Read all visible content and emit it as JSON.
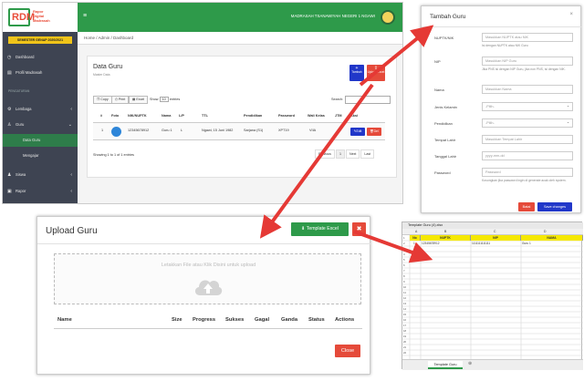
{
  "app": {
    "logo_letters": "RDM",
    "logo_text": [
      "Rapor",
      "Digital",
      "Madrasah"
    ],
    "semester": "SEMESTER GENAP 2020/2021",
    "school_name": "MADRASAH TSANAWIYAH NEGERI 1 NGAWI",
    "menu_icon": "hamburger-icon",
    "breadcrumb": "Home  /  Admin  /  Dashboard",
    "sidebar": {
      "items": [
        {
          "label": "Dashboard",
          "icon": "dashboard-icon"
        },
        {
          "label": "Profil Madrasah",
          "icon": "document-icon"
        }
      ],
      "section_header": "PENGATURAN",
      "items2": [
        {
          "label": "Lembaga",
          "icon": "gear-icon"
        },
        {
          "label": "Guru",
          "icon": "user-icon"
        },
        {
          "label": "Data Guru",
          "icon": ""
        },
        {
          "label": "Mengajar",
          "icon": ""
        },
        {
          "label": "Siswa",
          "icon": "group-icon"
        },
        {
          "label": "Rapor",
          "icon": "report-icon"
        }
      ]
    },
    "panel": {
      "title": "Data Guru",
      "subtitle": "Master Data",
      "tambah_label": "Tambah",
      "upload_label": "Upload Excel",
      "toolbar": {
        "copy": "Copy",
        "print": "Print",
        "excel": "Excel",
        "show": "Show",
        "show_value": "10",
        "entries": "entries",
        "search": "Search:"
      },
      "table": {
        "headers": [
          "#",
          "Foto",
          "NIK/NUPTK",
          "Nama",
          "L/P",
          "TTL",
          "Pendidikan",
          "Password",
          "Wali Kelas",
          "JTM",
          "Aksi"
        ],
        "rows": [
          {
            "no": "1",
            "nik": "12345678912",
            "nama": "Guru 1",
            "lp": "L",
            "ttl": "Ngawi, 15 Juni 1982",
            "pendidikan": "Sarjana (S1)",
            "password": "XPT19",
            "wali": "VIIA",
            "jtm": "0",
            "edit": "Edit",
            "del": "Del"
          }
        ]
      },
      "footer": "Showing 1 to 1 of 1 entries",
      "pager": {
        "prev": "Previous",
        "page": "1",
        "next": "Next",
        "last": "Last"
      }
    }
  },
  "tambah_modal": {
    "title": "Tambah Guru",
    "close": "×",
    "fields": [
      {
        "label": "NUPTK/NIK",
        "placeholder": "Masukkan NUPTK atau NIK",
        "help": "Isi dengan NUPTK atau NIK Guru"
      },
      {
        "label": "NIP",
        "placeholder": "Masukkan NIP Guru",
        "help": "Jika PNS isi dengan NIP Guru, jika non PNS, isi dengan NIK."
      },
      {
        "label": "Nama",
        "placeholder": "Masukkan Nama",
        "help": ""
      },
      {
        "label": "Jenis Kelamin",
        "placeholder": "-Pilih-",
        "help": ""
      },
      {
        "label": "Pendidikan",
        "placeholder": "-Pilih-",
        "help": ""
      },
      {
        "label": "Tempat Lahir",
        "placeholder": "Masukkan Tempat Lahir",
        "help": ""
      },
      {
        "label": "Tanggal Lahir",
        "placeholder": "yyyy-mm-dd",
        "help": ""
      },
      {
        "label": "Password",
        "placeholder": "Password",
        "help": "Kosongkan jika password ingin di generate acak oleh system."
      }
    ],
    "batal": "Batal",
    "save": "Save changes"
  },
  "upload_modal": {
    "title": "Upload Guru",
    "template_btn": "Template Excel",
    "close_x": "✖",
    "dropzone_text": "Letakkan File atau Klik Disini untuk upload",
    "headers": [
      "Name",
      "Size",
      "Progress",
      "Sukses",
      "Gagal",
      "Ganda",
      "Status",
      "Actions"
    ],
    "close_btn": "Close"
  },
  "excel": {
    "title": "Template Guru (4).xlsx",
    "cols": [
      "A",
      "B",
      "C",
      "D"
    ],
    "headers": [
      "No",
      "NUPTK",
      "NIP",
      "NAMA"
    ],
    "row": [
      "1",
      "12345678912",
      "1111111111111",
      "Guru 1"
    ],
    "row_numbers": [
      "1",
      "2",
      "3",
      "4",
      "5",
      "6",
      "7",
      "8",
      "9",
      "10",
      "11",
      "12",
      "13",
      "14",
      "15",
      "16",
      "17",
      "18",
      "19",
      "20",
      "21",
      "22"
    ],
    "tab": "Template Guru",
    "add_sheet": "⊕"
  },
  "colors": {
    "accent": "#2e9a4a",
    "danger": "#e54a3a",
    "primary": "#2137c9",
    "arrow": "#e53935"
  }
}
